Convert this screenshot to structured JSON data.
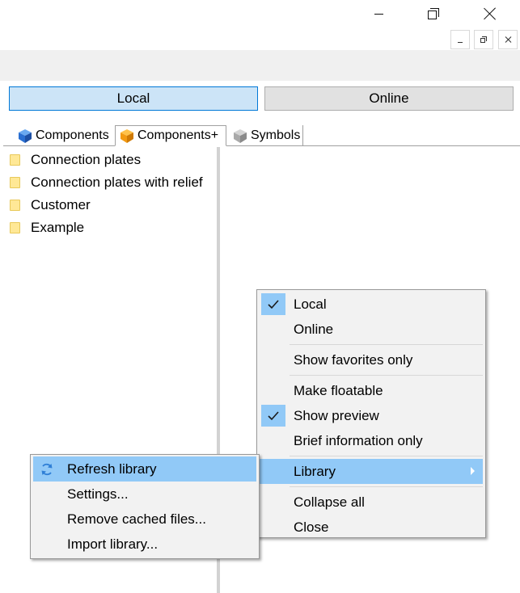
{
  "window": {
    "caption_buttons": [
      "minimize",
      "maximize",
      "close"
    ],
    "mdi_buttons": [
      "minimize",
      "restore",
      "close"
    ]
  },
  "source_toggle": {
    "local_label": "Local",
    "online_label": "Online",
    "selected": "Local"
  },
  "tabs": [
    {
      "label": "Components",
      "icon": "cube-blue-icon",
      "active": false
    },
    {
      "label": "Components+",
      "icon": "cube-orange-icon",
      "active": true
    },
    {
      "label": "Symbols",
      "icon": "cube-grey-icon",
      "active": false
    }
  ],
  "tree": {
    "items": [
      {
        "label": "Connection plates",
        "icon": "folder-icon"
      },
      {
        "label": "Connection plates with relief",
        "icon": "folder-icon"
      },
      {
        "label": "Customer",
        "icon": "folder-icon"
      },
      {
        "label": "Example",
        "icon": "folder-icon"
      }
    ]
  },
  "context_menu": {
    "items": [
      {
        "label": "Local",
        "checked": true
      },
      {
        "label": "Online",
        "checked": false
      },
      {
        "label": "Show favorites only",
        "checked": false
      },
      {
        "label": "Make floatable",
        "checked": false
      },
      {
        "label": "Show preview",
        "checked": true
      },
      {
        "label": "Brief information only",
        "checked": false
      },
      {
        "label": "Library",
        "submenu": true,
        "highlighted": true
      },
      {
        "label": "Collapse all"
      },
      {
        "label": "Close"
      }
    ]
  },
  "library_submenu": {
    "items": [
      {
        "label": "Refresh library",
        "icon": "refresh-icon",
        "highlighted": true
      },
      {
        "label": "Settings..."
      },
      {
        "label": "Remove cached files..."
      },
      {
        "label": "Import library..."
      }
    ]
  },
  "colors": {
    "highlight": "#91c9f7",
    "local_selected_bg": "#cce4f7",
    "local_selected_border": "#0078d7",
    "folder": "#ffe896"
  }
}
